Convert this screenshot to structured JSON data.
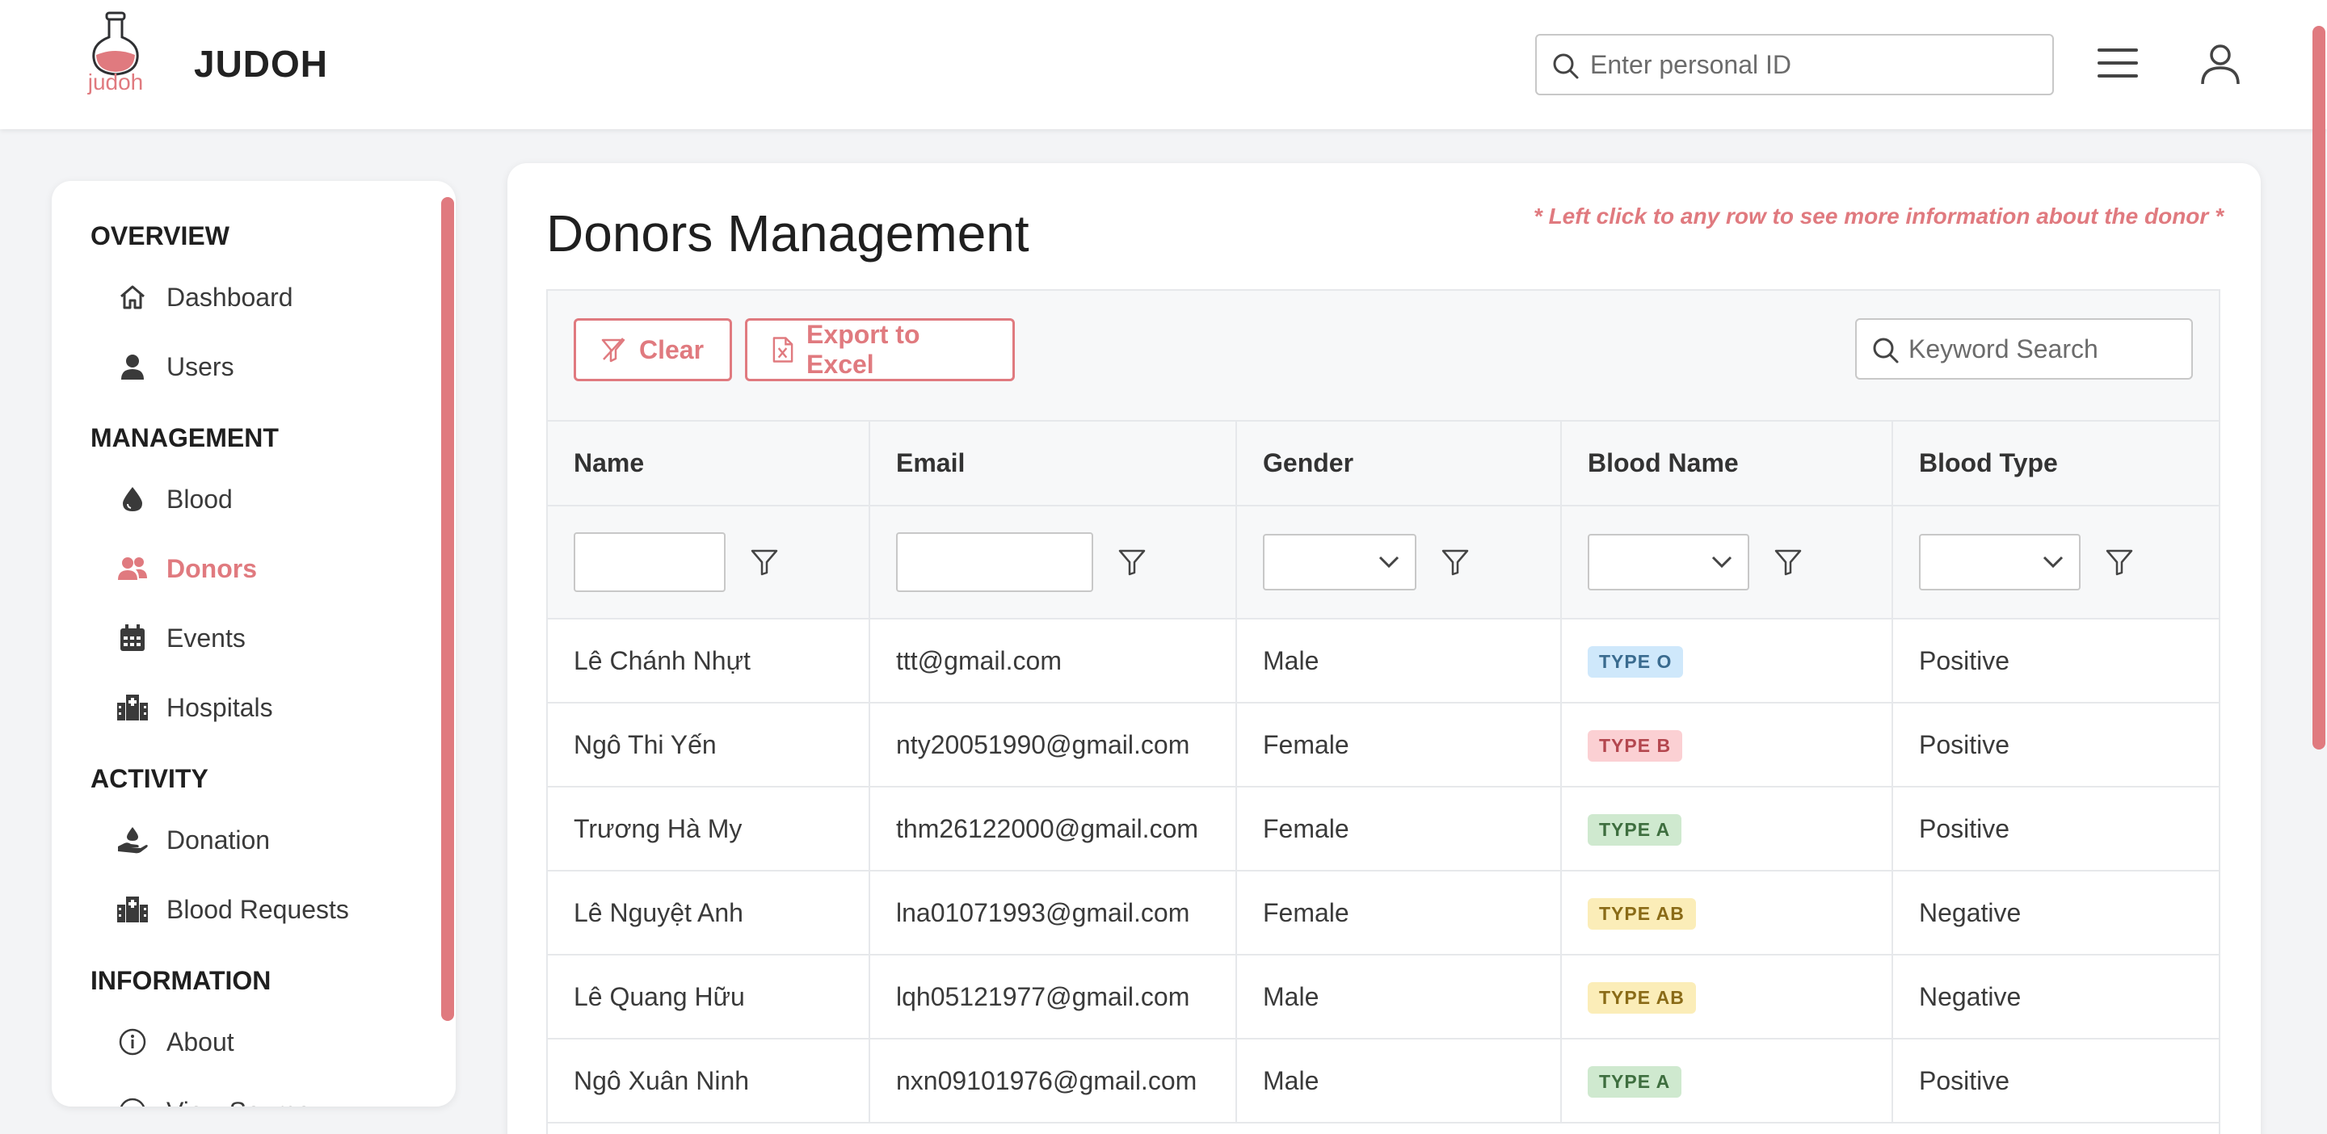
{
  "app": {
    "brand": "JUDOH",
    "logo_text": "judoh"
  },
  "header": {
    "search_placeholder": "Enter personal ID"
  },
  "sidebar": {
    "sections": [
      {
        "title": "OVERVIEW",
        "items": [
          {
            "label": "Dashboard",
            "icon": "home-icon"
          },
          {
            "label": "Users",
            "icon": "user-icon"
          }
        ]
      },
      {
        "title": "MANAGEMENT",
        "items": [
          {
            "label": "Blood",
            "icon": "droplet-icon"
          },
          {
            "label": "Donors",
            "icon": "users-icon",
            "active": true
          },
          {
            "label": "Events",
            "icon": "calendar-icon"
          },
          {
            "label": "Hospitals",
            "icon": "hospital-icon"
          }
        ]
      },
      {
        "title": "ACTIVITY",
        "items": [
          {
            "label": "Donation",
            "icon": "hand-holding-drop-icon"
          },
          {
            "label": "Blood Requests",
            "icon": "hospital-icon"
          }
        ]
      },
      {
        "title": "INFORMATION",
        "items": [
          {
            "label": "About",
            "icon": "info-circle-icon"
          },
          {
            "label": "View Source",
            "icon": "code-circle-icon"
          }
        ]
      }
    ]
  },
  "main": {
    "title": "Donors Management",
    "hint": "* Left click to any row to see more information about the donor *",
    "toolbar": {
      "clear_label": "Clear",
      "export_label": "Export to Excel",
      "keyword_placeholder": "Keyword Search"
    },
    "columns": [
      "Name",
      "Email",
      "Gender",
      "Blood Name",
      "Blood Type"
    ],
    "rows": [
      {
        "name": "Lê Chánh Nhựt",
        "email": "ttt@gmail.com",
        "gender": "Male",
        "blood_name": "TYPE O",
        "blood_class": "o",
        "blood_type": "Positive"
      },
      {
        "name": "Ngô Thi Yến",
        "email": "nty20051990@gmail.com",
        "gender": "Female",
        "blood_name": "TYPE B",
        "blood_class": "b",
        "blood_type": "Positive"
      },
      {
        "name": "Trương Hà My",
        "email": "thm26122000@gmail.com",
        "gender": "Female",
        "blood_name": "TYPE A",
        "blood_class": "a",
        "blood_type": "Positive"
      },
      {
        "name": "Lê Nguyệt Anh",
        "email": "lna01071993@gmail.com",
        "gender": "Female",
        "blood_name": "TYPE AB",
        "blood_class": "ab",
        "blood_type": "Negative"
      },
      {
        "name": "Lê Quang Hữu",
        "email": "lqh05121977@gmail.com",
        "gender": "Male",
        "blood_name": "TYPE AB",
        "blood_class": "ab",
        "blood_type": "Negative"
      },
      {
        "name": "Ngô Xuân Ninh",
        "email": "nxn09101976@gmail.com",
        "gender": "Male",
        "blood_name": "TYPE A",
        "blood_class": "a",
        "blood_type": "Positive"
      }
    ]
  },
  "colors": {
    "accent": "#e07a7f",
    "tag_o": "#cfe8fb",
    "tag_b": "#fbd0d3",
    "tag_a": "#cfe9cf",
    "tag_ab": "#fbedb8"
  }
}
